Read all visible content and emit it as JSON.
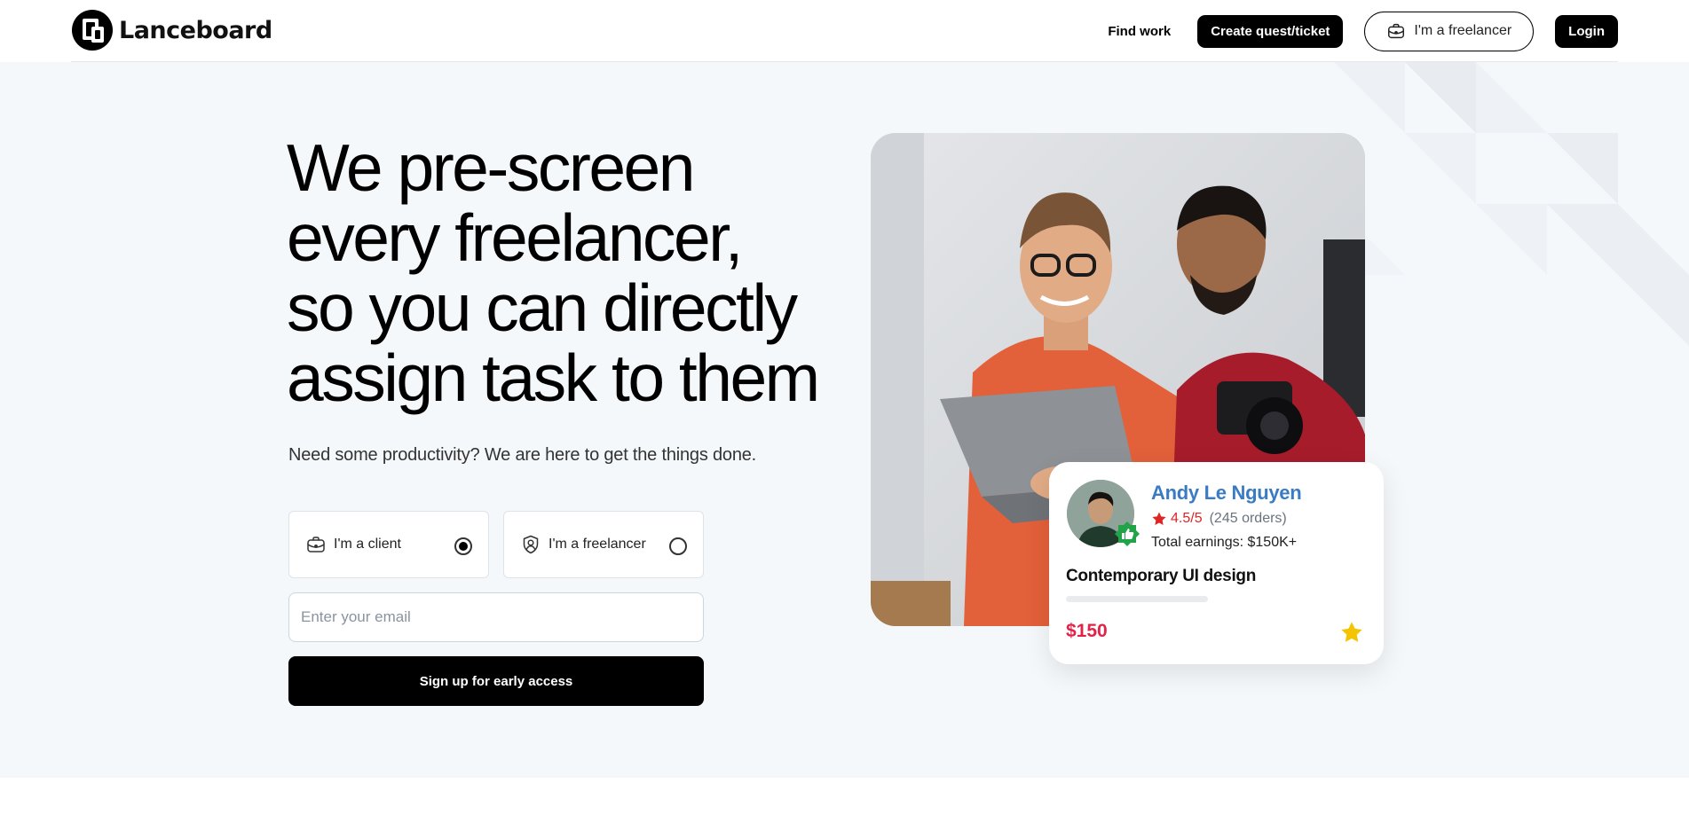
{
  "brand": {
    "name": "Lanceboard"
  },
  "nav": {
    "find_work": "Find work",
    "create": "Create quest/ticket",
    "freelancer": "I'm a freelancer",
    "login": "Login"
  },
  "hero": {
    "headline": "We pre-screen every freelancer, so you can directly assign task to them",
    "subtitle": "Need some productivity? We are here to get the things done.",
    "roles": [
      {
        "label": "I'm a client",
        "icon": "briefcase-icon",
        "selected": true
      },
      {
        "label": "I'm a freelancer",
        "icon": "user-badge-icon",
        "selected": false
      }
    ],
    "email_placeholder": "Enter your email",
    "signup_label": "Sign up for early access"
  },
  "profile": {
    "name": "Andy Le Nguyen",
    "rating": "4.5/5",
    "orders": "(245 orders)",
    "earnings": "Total earnings: $150K+",
    "title": "Contemporary UI design",
    "price": "$150"
  },
  "colors": {
    "accent_blue": "#3a7cc4",
    "rating_red": "#e02424",
    "price_red": "#e02449",
    "star_yellow": "#f5c400",
    "verified_green": "#22a34a",
    "hero_bg": "#f5f8fb"
  }
}
